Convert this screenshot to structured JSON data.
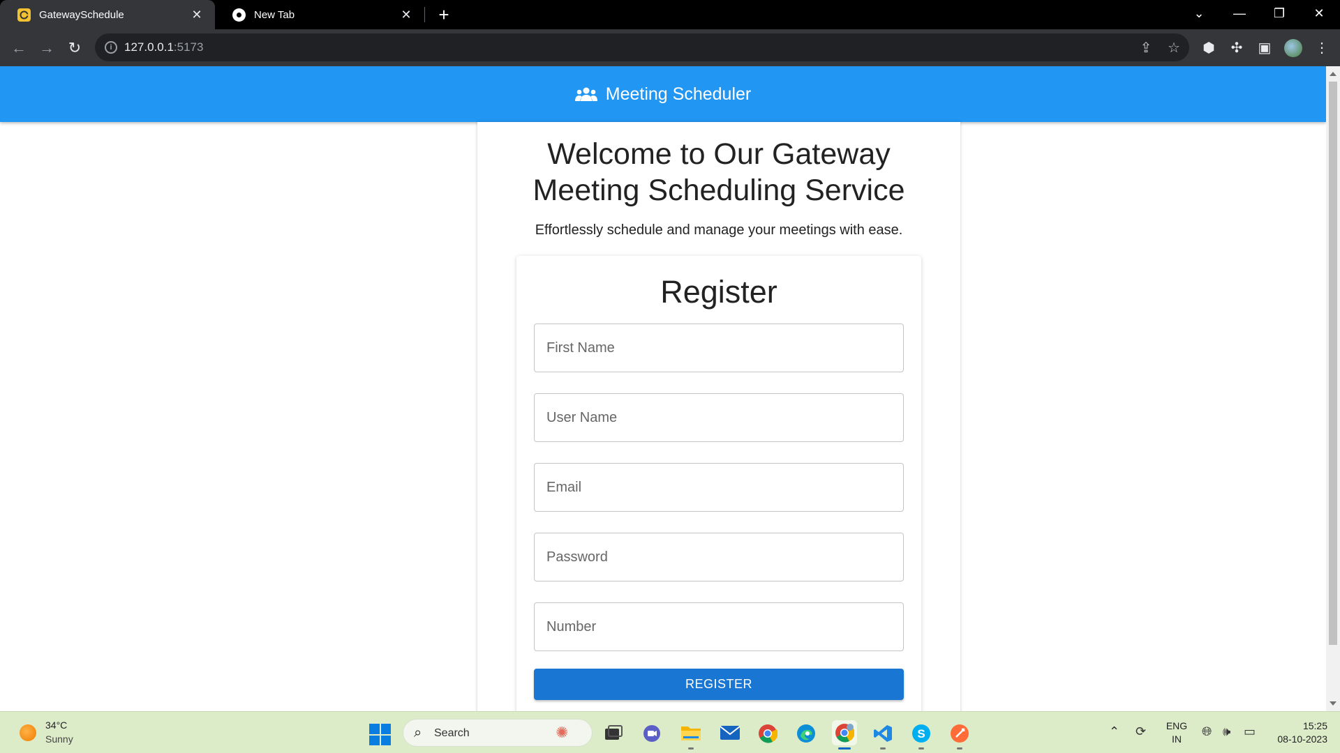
{
  "browser": {
    "tabs": [
      {
        "title": "GatewaySchedule",
        "close": "✕"
      },
      {
        "title": "New Tab",
        "close": "✕"
      }
    ],
    "new_tab": "+",
    "window_controls": {
      "list": "⌄",
      "minimize": "—",
      "restore": "❐",
      "close": "✕"
    },
    "address": {
      "host": "127.0.0.1",
      "port": ":5173"
    }
  },
  "page": {
    "app_title": "Meeting Scheduler",
    "welcome_line1": "Welcome to Our Gateway",
    "welcome_line2": "Meeting Scheduling Service",
    "tagline": "Effortlessly schedule and manage your meetings with ease.",
    "form": {
      "title": "Register",
      "fields": [
        {
          "placeholder": "First Name",
          "value": ""
        },
        {
          "placeholder": "User Name",
          "value": ""
        },
        {
          "placeholder": "Email",
          "value": ""
        },
        {
          "placeholder": "Password",
          "value": ""
        },
        {
          "placeholder": "Number",
          "value": ""
        }
      ],
      "submit_label": "REGISTER"
    },
    "colors": {
      "appbar": "#2196f3",
      "button": "#1976d2"
    }
  },
  "taskbar": {
    "weather": {
      "temp": "34°C",
      "desc": "Sunny"
    },
    "search_label": "Search",
    "apps": [
      "windows-start",
      "task-view",
      "teams-chat",
      "file-explorer",
      "mail",
      "chrome",
      "edge",
      "chrome-profile",
      "vscode",
      "skype",
      "postman"
    ],
    "tray": {
      "lang_top": "ENG",
      "lang_bottom": "IN",
      "time": "15:25",
      "date": "08-10-2023"
    }
  }
}
